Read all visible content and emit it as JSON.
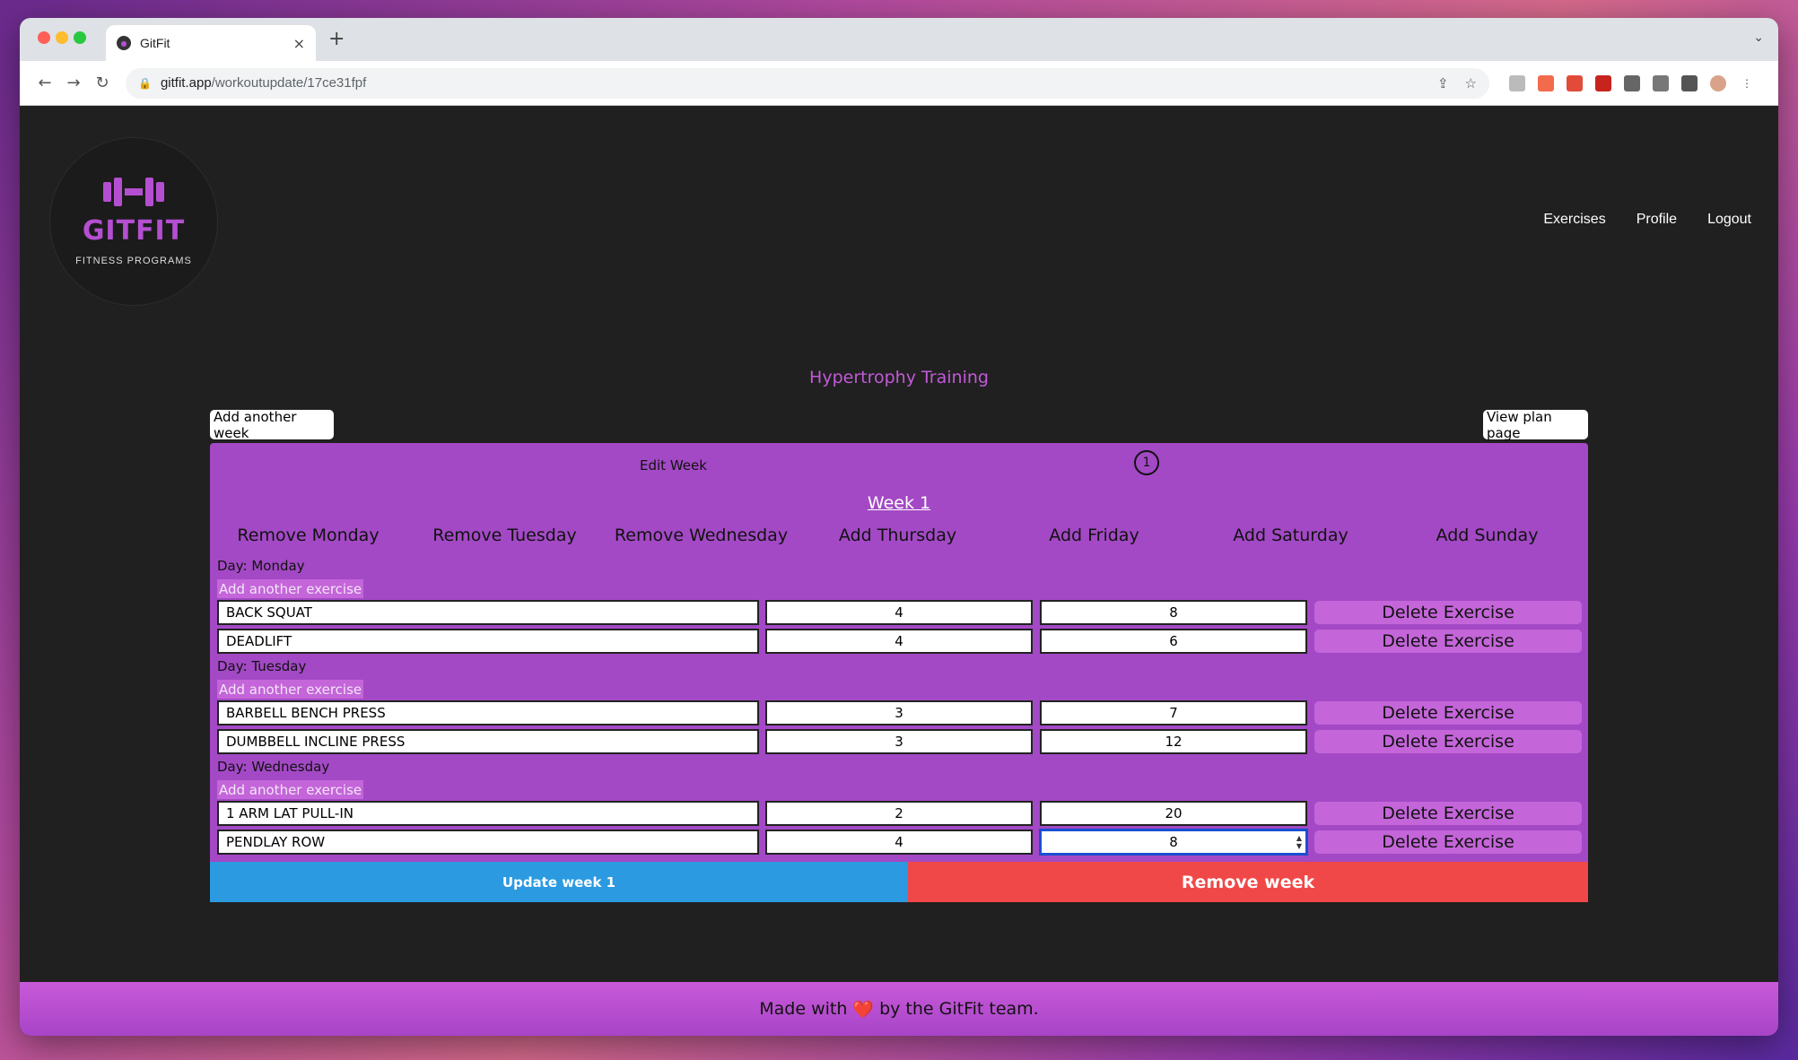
{
  "browser": {
    "tab_title": "GitFit",
    "tab_close": "×",
    "new_tab": "+",
    "url_host": "gitfit.app",
    "url_path": "/workoutupdate/17ce31fpf"
  },
  "header": {
    "logo_title": "GITFIT",
    "logo_subtitle": "FITNESS PROGRAMS",
    "nav": [
      "Exercises",
      "Profile",
      "Logout"
    ]
  },
  "plan": {
    "title": "Hypertrophy Training",
    "add_week_label": "Add another week",
    "view_plan_label": "View plan page"
  },
  "week": {
    "edit_label": "Edit Week",
    "number": "1",
    "title": "Week 1",
    "day_toggles": [
      "Remove Monday",
      "Remove Tuesday",
      "Remove Wednesday",
      "Add Thursday",
      "Add Friday",
      "Add Saturday",
      "Add Sunday"
    ],
    "add_exercise_label": "Add another exercise",
    "delete_label": "Delete Exercise",
    "days": [
      {
        "label": "Day: Monday",
        "exercises": [
          {
            "name": "BACK SQUAT",
            "sets": "4",
            "reps": "8"
          },
          {
            "name": "DEADLIFT",
            "sets": "4",
            "reps": "6"
          }
        ]
      },
      {
        "label": "Day: Tuesday",
        "exercises": [
          {
            "name": "BARBELL BENCH PRESS",
            "sets": "3",
            "reps": "7"
          },
          {
            "name": "DUMBBELL INCLINE PRESS",
            "sets": "3",
            "reps": "12"
          }
        ]
      },
      {
        "label": "Day: Wednesday",
        "exercises": [
          {
            "name": "1 ARM LAT PULL-IN",
            "sets": "2",
            "reps": "20"
          },
          {
            "name": "PENDLAY ROW",
            "sets": "4",
            "reps": "8"
          }
        ]
      }
    ],
    "update_label": "Update week 1",
    "remove_label": "Remove week"
  },
  "footer": {
    "prefix": "Made with",
    "heart": "❤️",
    "suffix": "by the GitFit team."
  }
}
